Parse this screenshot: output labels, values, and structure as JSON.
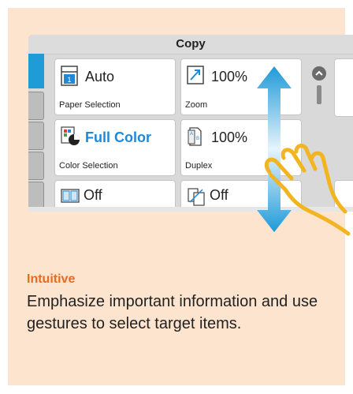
{
  "window": {
    "title": "Copy"
  },
  "tiles": [
    {
      "value": "Auto",
      "caption": "Paper Selection",
      "icon": "paper-tray-icon"
    },
    {
      "value": "100%",
      "caption": "Zoom",
      "icon": "zoom-icon"
    },
    {
      "value": "Full Color",
      "caption": "Color Selection",
      "icon": "color-icon"
    },
    {
      "value": "100%",
      "caption": "Duplex",
      "icon": "duplex-icon"
    },
    {
      "value": "Off",
      "caption": "",
      "icon": "combine-icon"
    },
    {
      "value": "Off",
      "caption": "",
      "icon": "original-size-icon"
    }
  ],
  "feature": {
    "heading": "Intuitive",
    "description": "Emphasize important information and use gestures to select target items."
  },
  "colors": {
    "accent_blue": "#1f88d8",
    "heading_orange": "#e86a1c",
    "card_bg": "#fde4cf",
    "gesture_yellow": "#f3b51f"
  }
}
